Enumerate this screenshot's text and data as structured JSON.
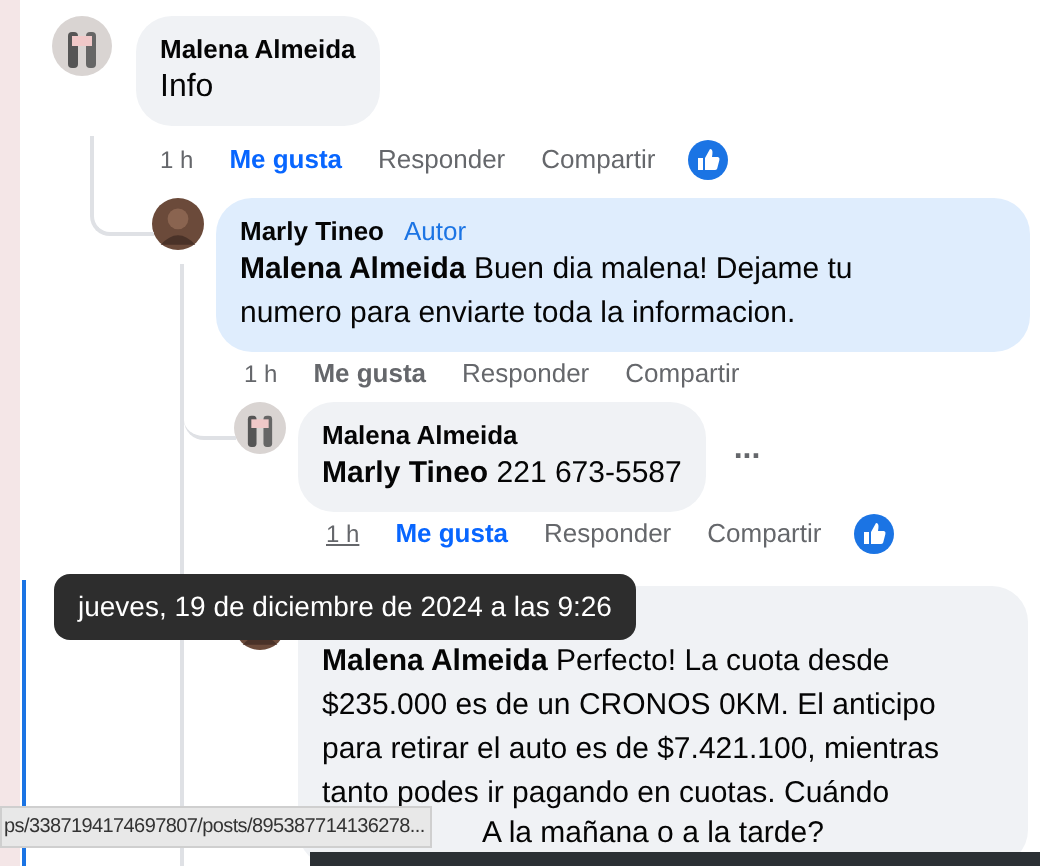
{
  "comments": [
    {
      "author": "Malena Almeida",
      "text": "Info",
      "time": "1 h",
      "time_underlined": false,
      "actions": [
        "Me gusta",
        "Responder",
        "Compartir"
      ],
      "like_selected": true,
      "reaction": true,
      "highlighted": false,
      "children": [
        {
          "author": "Marly Tineo",
          "badge": "Autor",
          "text": "**Malena Almeida** Buen dia malena! Dejame tu numero para enviarte toda la informacion.",
          "time": "1 h",
          "time_underlined": false,
          "actions": [
            "Me gusta",
            "Responder",
            "Compartir"
          ],
          "like_selected": false,
          "reaction": false,
          "highlighted": true,
          "children": [
            {
              "author": "Malena Almeida",
              "text": "**Marly Tineo** 221 673-5587",
              "more": "...",
              "time": "1 h",
              "time_underlined": true,
              "actions": [
                "Me gusta",
                "Responder",
                "Compartir"
              ],
              "like_selected": true,
              "reaction": true,
              "highlighted": false
            },
            {
              "text": "**Malena Almeida** Perfecto! La cuota desde $235.000 es de un CRONOS 0KM. El anticipo para retirar el auto es de $7.421.100, mientras tanto podes ir pagando en cuotas. Cuándo",
              "text_tail": "A la mañana o a la tarde?",
              "highlighted": false
            }
          ]
        }
      ]
    }
  ],
  "tooltip": "jueves, 19 de diciembre de 2024 a las 9:26",
  "status_bar": "ps/3387194174697807/posts/895387714136278..."
}
